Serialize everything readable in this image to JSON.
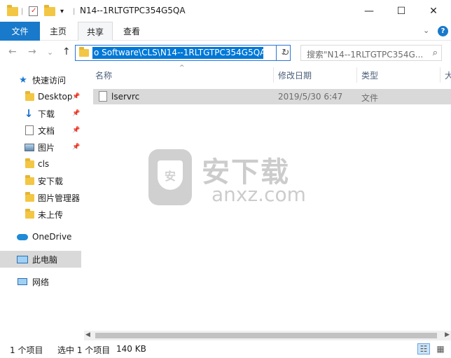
{
  "window": {
    "title": "N14--1RLTGTPC354G5QA",
    "minimize": "—",
    "maximize": "☐",
    "close": "✕"
  },
  "ribbon": {
    "tabs": [
      "文件",
      "主页",
      "共享",
      "查看"
    ],
    "collapse": "⌄",
    "help": "?"
  },
  "nav": {
    "back": "←",
    "forward": "→",
    "recent": "⌄",
    "up": "↑",
    "address": "o Software\\CLS\\N14--1RLTGTPC354G5QA",
    "address_dropdown": "⌄",
    "refresh": "↻",
    "search_placeholder": "搜索\"N14--1RLTGTPC354G...",
    "search_icon": "⌕"
  },
  "sidebar": {
    "items": [
      {
        "label": "快速访问",
        "icon": "star-icon"
      },
      {
        "label": "Desktop",
        "icon": "folder-icon",
        "pinned": true
      },
      {
        "label": "下载",
        "icon": "download-icon",
        "pinned": true
      },
      {
        "label": "文档",
        "icon": "document-icon",
        "pinned": true
      },
      {
        "label": "图片",
        "icon": "picture-icon",
        "pinned": true
      },
      {
        "label": "cls",
        "icon": "folder-icon"
      },
      {
        "label": "安下载",
        "icon": "folder-icon"
      },
      {
        "label": "图片管理器",
        "icon": "folder-icon"
      },
      {
        "label": "未上传",
        "icon": "folder-icon"
      },
      {
        "label": "OneDrive",
        "icon": "onedrive-icon"
      },
      {
        "label": "此电脑",
        "icon": "computer-icon",
        "selected": true
      },
      {
        "label": "网络",
        "icon": "network-icon"
      }
    ],
    "pin_glyph": "📌"
  },
  "list": {
    "columns": [
      "名称",
      "修改日期",
      "类型",
      "大"
    ],
    "sort_glyph": "^",
    "rows": [
      {
        "name": "lservrc",
        "modified": "2019/5/30 6:47",
        "type": "文件"
      }
    ]
  },
  "watermark": {
    "shield_text": "安",
    "cn": "安下载",
    "en": "anxz.com"
  },
  "scroll": {
    "left": "◀",
    "right": "▶"
  },
  "status": {
    "count": "1 个项目",
    "selected": "选中 1 个项目",
    "size": "140 KB",
    "details_view": "☷",
    "icons_view": "▦"
  },
  "colors": {
    "accent": "#1979ca",
    "selection": "#0078d7",
    "folder": "#f3c744",
    "row_highlight": "#d9d9d9"
  }
}
